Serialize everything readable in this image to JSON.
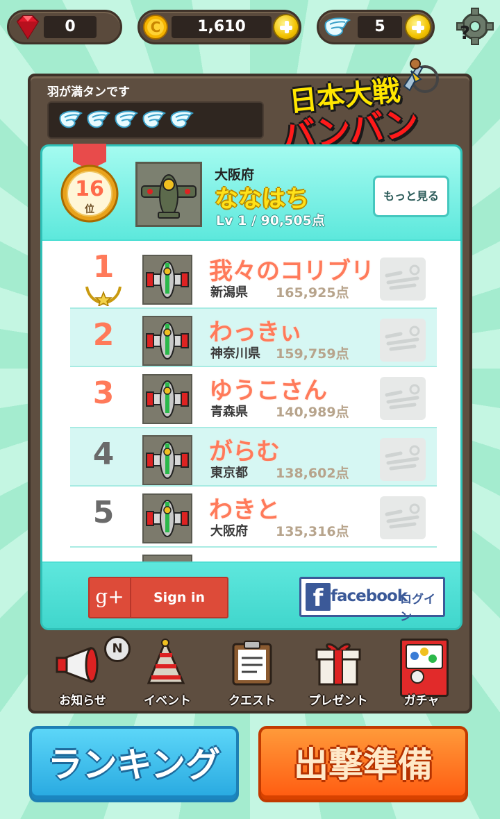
{
  "currency": {
    "gems": "0",
    "coins": "1,610",
    "wings": "5"
  },
  "panel": {
    "wing_status": "羽が満タンです",
    "wing_count": 5
  },
  "logo": {
    "line1": "日本大戦",
    "line2": "バンバン"
  },
  "my_rank": {
    "rank": "16",
    "rank_suffix": "位",
    "prefecture": "大阪府",
    "name": "ななはち",
    "stats": "Lv 1 / 90,505点",
    "more_button": "もっと見る"
  },
  "rankings": [
    {
      "rank": "1",
      "name": "我々のコリブリ",
      "prefecture": "新潟県",
      "score": "165,925点"
    },
    {
      "rank": "2",
      "name": "わっきぃ",
      "prefecture": "神奈川県",
      "score": "159,759点"
    },
    {
      "rank": "3",
      "name": "ゆうこさん",
      "prefecture": "青森県",
      "score": "140,989点"
    },
    {
      "rank": "4",
      "name": "がらむ",
      "prefecture": "東京都",
      "score": "138,602点"
    },
    {
      "rank": "5",
      "name": "わきと",
      "prefecture": "大阪府",
      "score": "135,316点"
    }
  ],
  "social": {
    "google_icon": "g+",
    "google_label": "Sign in",
    "facebook_brand": "facebook",
    "facebook_label": "ログイン"
  },
  "nav": {
    "news": "お知らせ",
    "news_badge": "N",
    "event": "イベント",
    "quest": "クエスト",
    "present": "プレゼント",
    "gacha": "ガチャ"
  },
  "buttons": {
    "ranking": "ランキング",
    "sortie": "出撃準備"
  },
  "colors": {
    "accent_cyan": "#4ddfd4",
    "rank_red": "#ff7a5a",
    "ranking_button": "#3cc3f0",
    "sortie_button": "#ff6a1a"
  }
}
